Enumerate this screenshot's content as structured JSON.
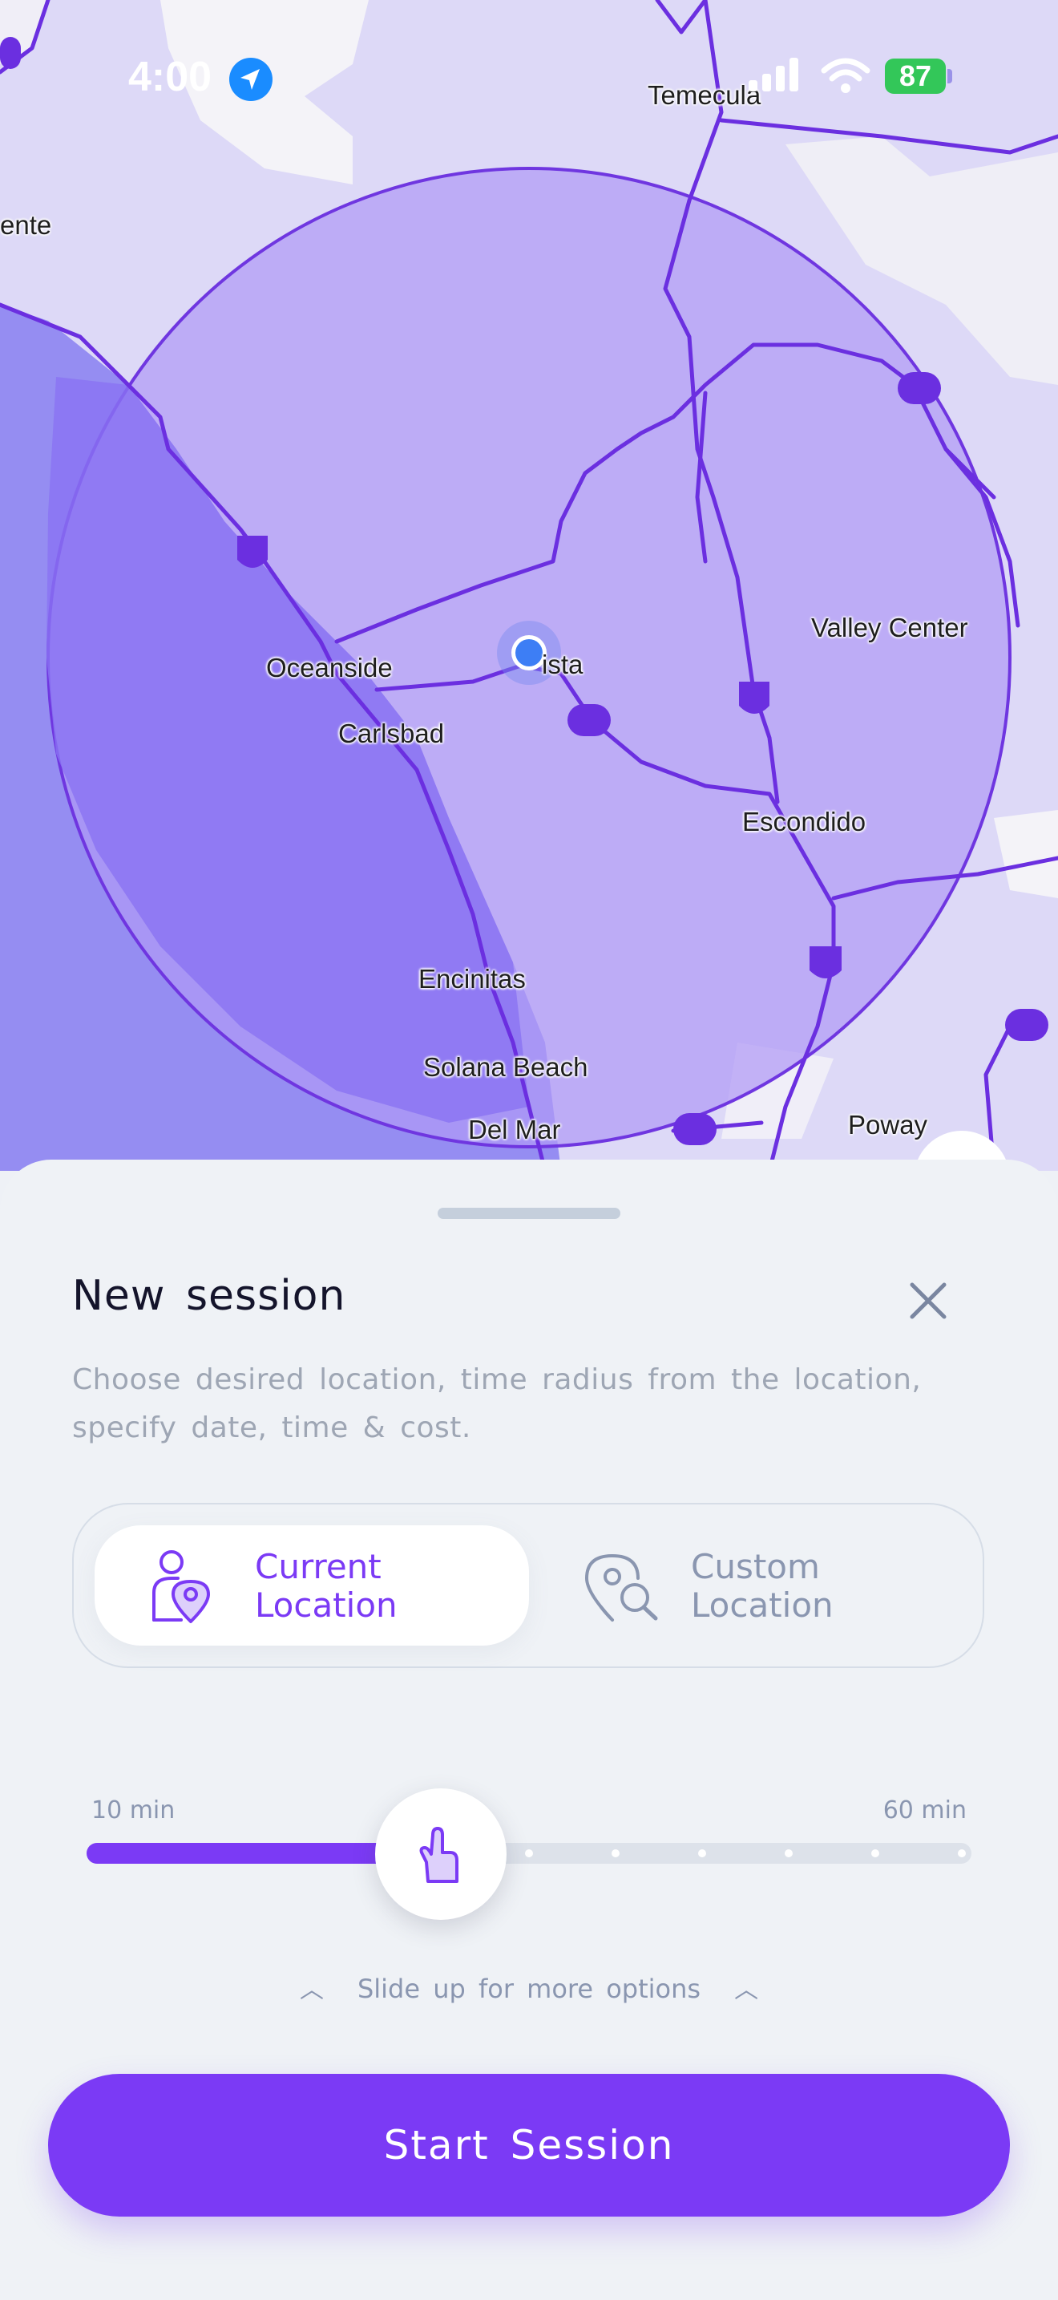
{
  "status_bar": {
    "time": "4:00",
    "battery": "87"
  },
  "map": {
    "labels": {
      "temecula": "Temecula",
      "fallbrook": "ente",
      "oceanside": "Oceanside",
      "vista": "ista",
      "carlsbad": "Carlsbad",
      "valley_center": "Valley Center",
      "escondido": "Escondido",
      "encinitas": "Encinitas",
      "solana_beach": "Solana Beach",
      "del_mar": "Del Mar",
      "poway": "Poway"
    }
  },
  "sheet": {
    "title": "New session",
    "description": "Choose desired location, time radius from the location, specify date, time & cost.",
    "location_toggle": {
      "current": "Current\nLocation",
      "custom": "Custom\nLocation",
      "selected": "current"
    },
    "time_slider": {
      "min_label": "10 min",
      "max_label": "60 min",
      "value_fraction": 0.4
    },
    "hint": "Slide up for more options",
    "start_button": "Start Session"
  },
  "colors": {
    "accent": "#7b3af5",
    "map_base": "#dcd8f7",
    "radius_fill": "#a98ff0",
    "water": "#8e7ff0"
  }
}
